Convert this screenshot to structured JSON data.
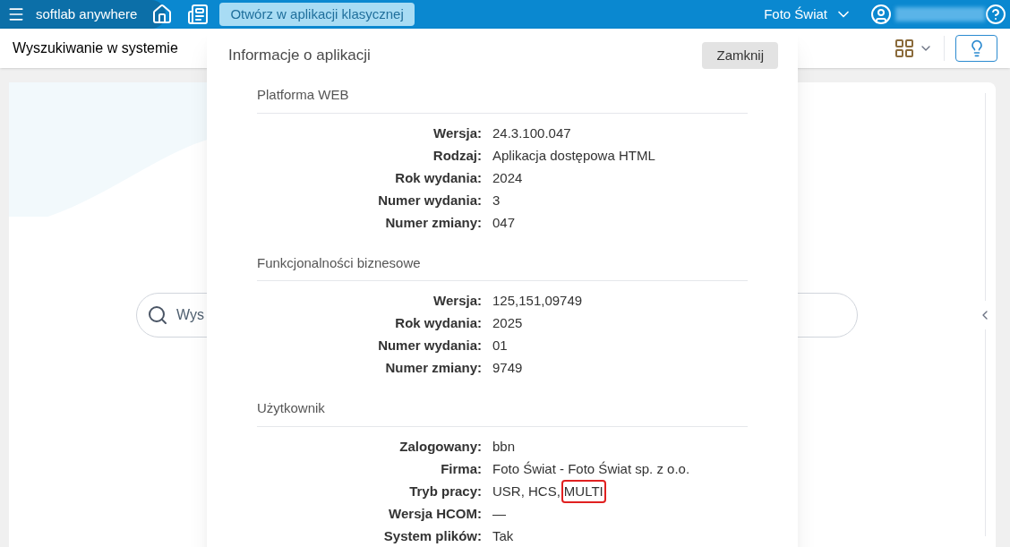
{
  "topbar": {
    "brand": "softlab anywhere",
    "open_classic_button": "Otwórz w aplikacji klasycznej",
    "company": "Foto Świat"
  },
  "toolbar": {
    "title": "Wyszukiwanie w systemie"
  },
  "search": {
    "placeholder": "Wys"
  },
  "dialog": {
    "title": "Informacje o aplikacji",
    "close_button": "Zamknij",
    "sections": [
      {
        "heading": "Platforma WEB",
        "rows": [
          {
            "label": "Wersja:",
            "value": [
              {
                "text": "24.3.100.047",
                "highlighted": false
              }
            ]
          },
          {
            "label": "Rodzaj:",
            "value": [
              {
                "text": "Aplikacja dostępowa HTML",
                "highlighted": false
              }
            ]
          },
          {
            "label": "Rok wydania:",
            "value": [
              {
                "text": "2024",
                "highlighted": false
              }
            ]
          },
          {
            "label": "Numer wydania:",
            "value": [
              {
                "text": "3",
                "highlighted": false
              }
            ]
          },
          {
            "label": "Numer zmiany:",
            "value": [
              {
                "text": "047",
                "highlighted": false
              }
            ]
          }
        ]
      },
      {
        "heading": "Funkcjonalności biznesowe",
        "rows": [
          {
            "label": "Wersja:",
            "value": [
              {
                "text": "125,151,09749",
                "highlighted": false
              }
            ]
          },
          {
            "label": "Rok wydania:",
            "value": [
              {
                "text": "2025",
                "highlighted": false
              }
            ]
          },
          {
            "label": "Numer wydania:",
            "value": [
              {
                "text": "01",
                "highlighted": false
              }
            ]
          },
          {
            "label": "Numer zmiany:",
            "value": [
              {
                "text": "9749",
                "highlighted": false
              }
            ]
          }
        ]
      },
      {
        "heading": "Użytkownik",
        "rows": [
          {
            "label": "Zalogowany:",
            "value": [
              {
                "text": "bbn",
                "highlighted": false
              }
            ]
          },
          {
            "label": "Firma:",
            "value": [
              {
                "text": "Foto Świat - Foto Świat sp. z o.o.",
                "highlighted": false
              }
            ]
          },
          {
            "label": "Tryb pracy:",
            "value": [
              {
                "text": "USR, HCS,",
                "highlighted": false
              },
              {
                "text": "MULTI",
                "highlighted": true
              }
            ]
          },
          {
            "label": "Wersja HCOM:",
            "value": [
              {
                "text": "—",
                "highlighted": false
              }
            ]
          },
          {
            "label": "System plików:",
            "value": [
              {
                "text": "Tak",
                "highlighted": false
              }
            ]
          }
        ]
      }
    ]
  }
}
